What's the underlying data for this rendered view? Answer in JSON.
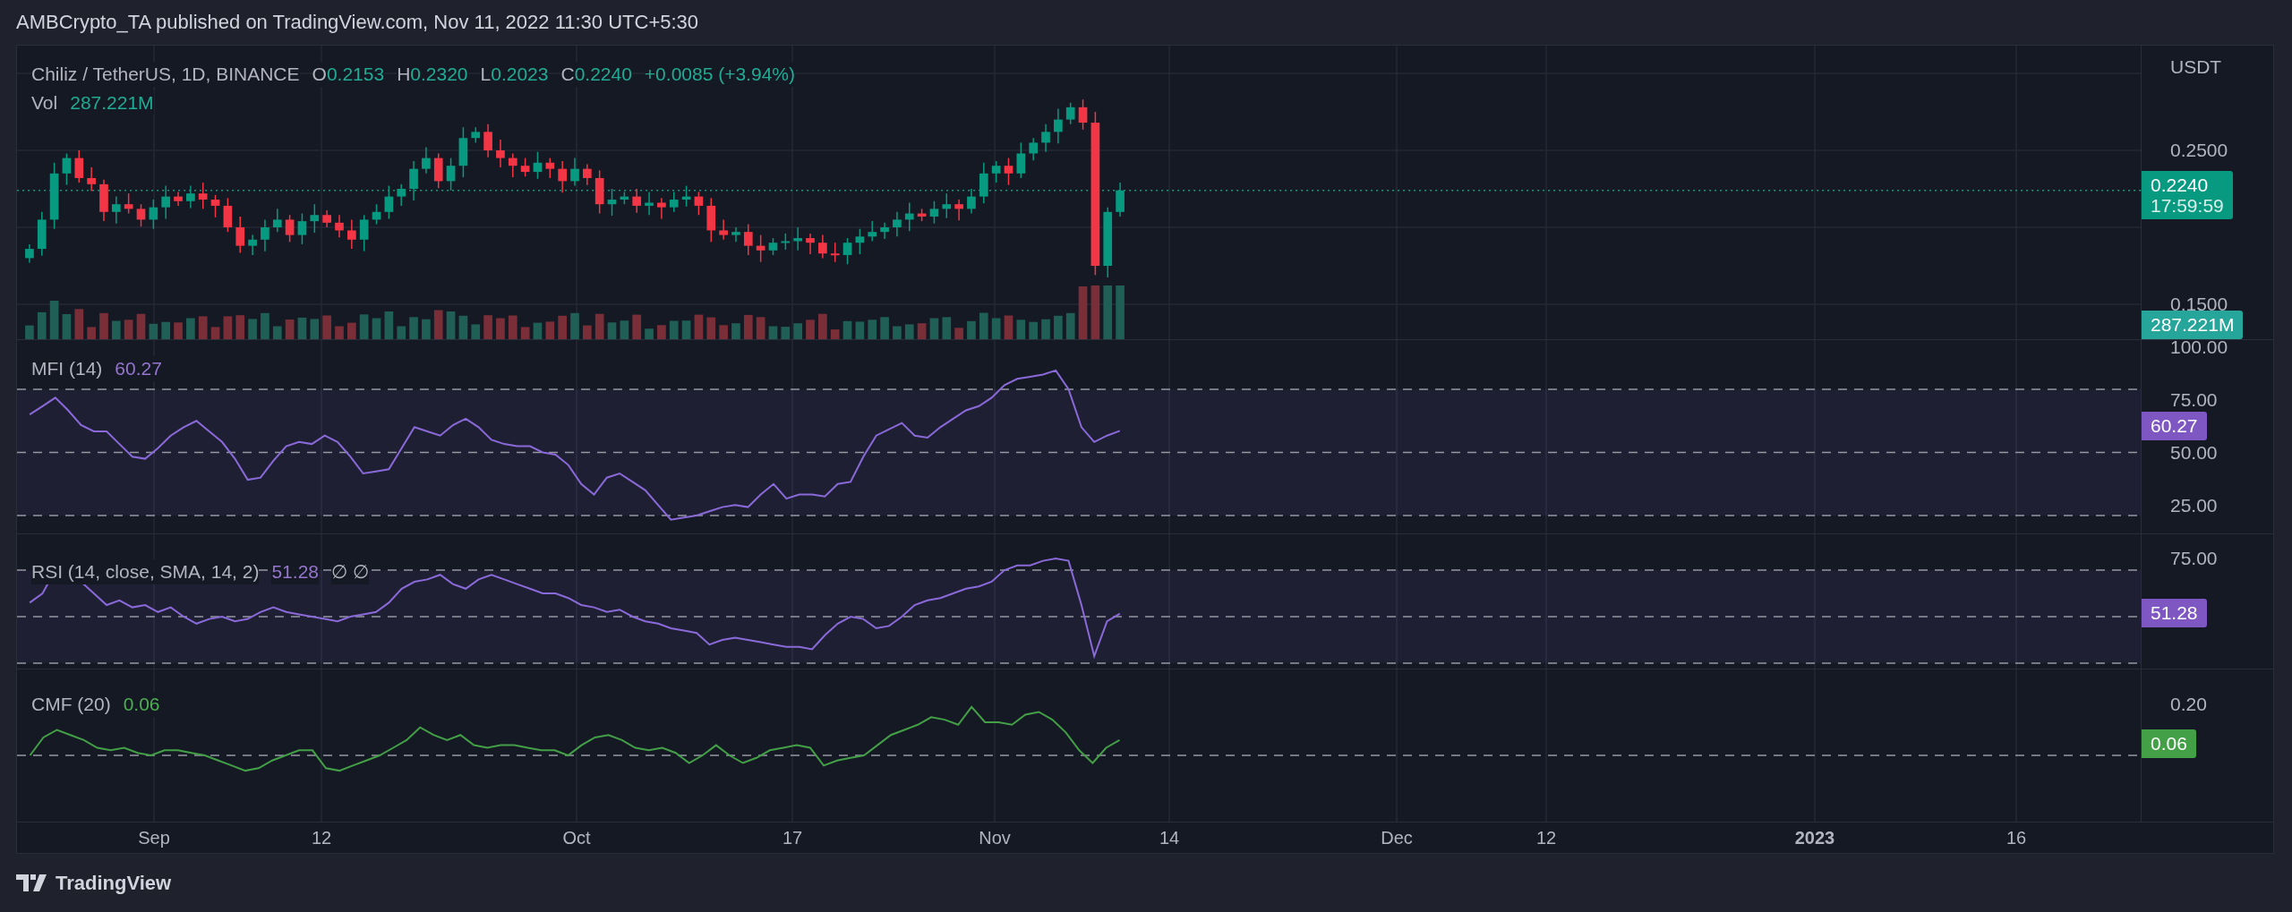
{
  "header": {
    "text": "AMBCrypto_TA published on TradingView.com, Nov 11, 2022 11:30 UTC+5:30"
  },
  "legend": {
    "symbol": "Chiliz / TetherUS, 1D, BINANCE",
    "ohlc": [
      {
        "label": "O",
        "value": "0.2153"
      },
      {
        "label": "H",
        "value": "0.2320"
      },
      {
        "label": "L",
        "value": "0.2023"
      },
      {
        "label": "C",
        "value": "0.2240"
      }
    ],
    "change": "+0.0085 (+3.94%)",
    "volume": {
      "label": "Vol",
      "value": "287.221M"
    }
  },
  "price_axis": {
    "unit": "USDT",
    "ticks": [
      "0.2500",
      "0.1500"
    ]
  },
  "price_badge": {
    "price": "0.2240",
    "countdown": "17:59:59",
    "color": "#089981"
  },
  "volume_badge": {
    "value": "287.221M",
    "color": "#26a69a"
  },
  "indicators": [
    {
      "kind": "mfi",
      "title": "MFI (14)",
      "value": "60.27",
      "ticks": [
        "100.00",
        "75.00",
        "50.00",
        "25.00"
      ],
      "badge": {
        "value": "60.27",
        "color": "#7e57c2"
      }
    },
    {
      "kind": "rsi",
      "title": "RSI (14, close, SMA, 14, 2)",
      "value": "51.28",
      "extra": "∅ ∅",
      "ticks": [
        "75.00"
      ],
      "badge": {
        "value": "51.28",
        "color": "#7e57c2"
      }
    },
    {
      "kind": "cmf",
      "title": "CMF (20)",
      "value": "0.06",
      "ticks": [
        "0.20"
      ],
      "badge": {
        "value": "0.06",
        "color": "#43a047"
      }
    }
  ],
  "time_axis": [
    {
      "label": "Sep",
      "kind": "month"
    },
    {
      "label": "12",
      "kind": "day"
    },
    {
      "label": "Oct",
      "kind": "month"
    },
    {
      "label": "17",
      "kind": "day"
    },
    {
      "label": "Nov",
      "kind": "month"
    },
    {
      "label": "14",
      "kind": "day"
    },
    {
      "label": "Dec",
      "kind": "month"
    },
    {
      "label": "12",
      "kind": "day"
    },
    {
      "label": "2023",
      "kind": "year"
    },
    {
      "label": "16",
      "kind": "day"
    }
  ],
  "footer": {
    "brand": "TradingView"
  }
}
